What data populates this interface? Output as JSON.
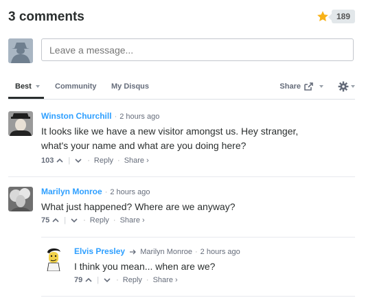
{
  "header": {
    "comment_count": "3 comments",
    "favorites_count": "189"
  },
  "composer": {
    "placeholder": "Leave a message..."
  },
  "tabs": {
    "best": "Best",
    "community": "Community",
    "my_disqus": "My Disqus",
    "share": "Share"
  },
  "comments": [
    {
      "author": "Winston Churchill",
      "time": "2 hours ago",
      "lines": [
        "It looks like we have a new visitor amongst us. Hey stranger,",
        "what's your name and what are you doing here?"
      ],
      "votes": "103",
      "reply": "Reply",
      "share": "Share ›"
    },
    {
      "author": "Marilyn Monroe",
      "time": "2 hours ago",
      "lines": [
        "What just happened? Where are we anyway?"
      ],
      "votes": "75",
      "reply": "Reply",
      "share": "Share ›"
    },
    {
      "author": "Elvis Presley",
      "reply_to": "Marilyn Monroe",
      "time": "2 hours ago",
      "lines": [
        "I think you mean... when are we?"
      ],
      "votes": "79",
      "reply": "Reply",
      "share": "Share ›"
    }
  ],
  "colors": {
    "link_blue": "#2e9fff",
    "star": "#f8b218",
    "text": "#2a2e2e",
    "muted": "#656c7a"
  },
  "icons": [
    "star-icon",
    "guest-avatar",
    "caret-down-icon",
    "share-icon",
    "gear-icon",
    "upvote-icon",
    "downvote-icon",
    "reply-arrow-icon"
  ]
}
